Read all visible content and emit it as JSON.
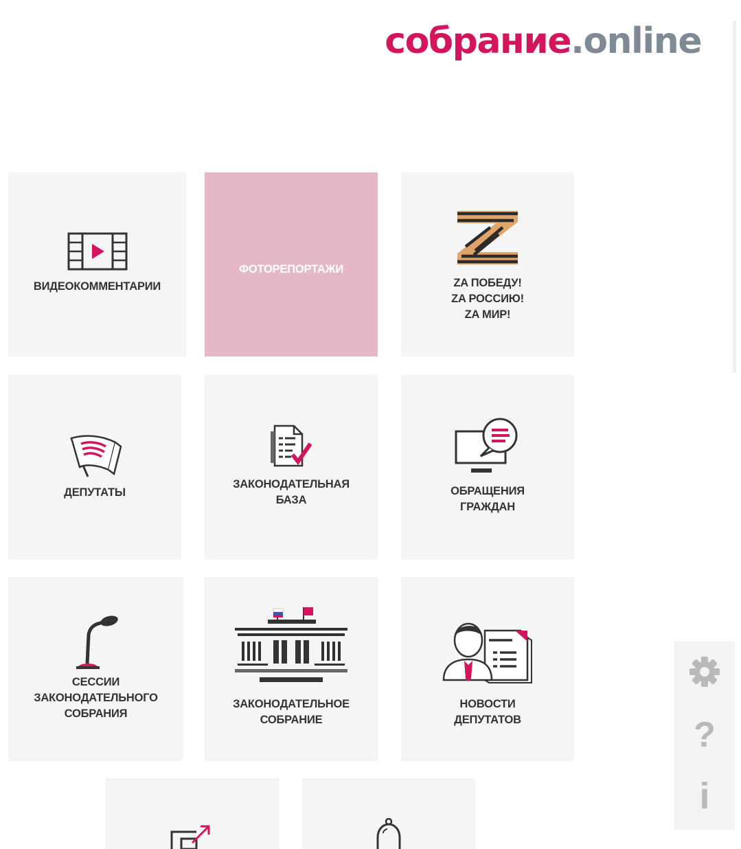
{
  "header": {
    "logo_primary": "собрание",
    "logo_secondary": ".online"
  },
  "tiles": [
    {
      "label": "ВИДЕОКОММЕНТАРИИ",
      "icon": "video-film-icon"
    },
    {
      "label": "ФОТОРЕПОРТАЖИ",
      "icon": "none",
      "state": "hover"
    },
    {
      "label": "ZA ПОБЕДУ!\nZA РОССИЮ!\nZA МИР!",
      "icon": "z-ribbon-icon"
    },
    {
      "label": "ДЕПУТАТЫ",
      "icon": "flag-icon"
    },
    {
      "label": "ЗАКОНОДАТЕЛЬНАЯ\nБАЗА",
      "icon": "document-check-icon"
    },
    {
      "label": "ОБРАЩЕНИЯ\nГРАЖДАН",
      "icon": "monitor-chat-icon"
    },
    {
      "label": "СЕССИИ\nЗАКОНОДАТЕЛЬНОГО\nСОБРАНИЯ",
      "icon": "microphone-icon"
    },
    {
      "label": "ЗАКОНОДАТЕЛЬНОЕ\nСОБРАНИЕ",
      "icon": "parliament-building-icon"
    },
    {
      "label": "НОВОСТИ\nДЕПУТАТОВ",
      "icon": "deputy-news-icon"
    },
    {
      "label": "",
      "icon": "external-link-icon"
    },
    {
      "label": "",
      "icon": "bell-icon"
    }
  ],
  "side_panel": {
    "items": [
      {
        "name": "settings",
        "icon": "gear-icon"
      },
      {
        "name": "help",
        "icon": "question-icon",
        "glyph": "?"
      },
      {
        "name": "info",
        "icon": "info-icon",
        "glyph": "i"
      }
    ]
  },
  "colors": {
    "brand": "#d3155d",
    "logo_grey": "#808a96",
    "tile_bg": "#f5f5f5",
    "tile_active_bg": "#e4b7c9",
    "icon_dark": "#444444",
    "side_icon": "#b9b9b9"
  }
}
